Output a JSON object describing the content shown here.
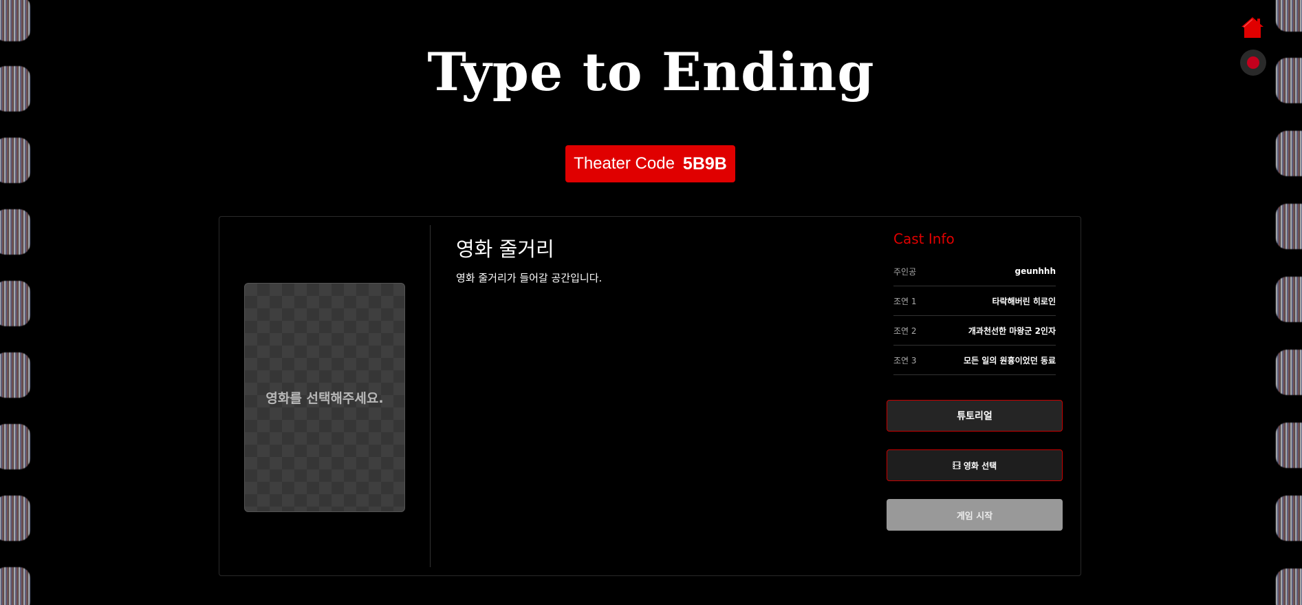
{
  "app": {
    "title": "Type to Ending"
  },
  "theater": {
    "label": "Theater Code",
    "code": "5B9B"
  },
  "poster": {
    "placeholder": "영화를 선택해주세요."
  },
  "synopsis": {
    "title": "영화 줄거리",
    "body": "영화 줄거리가 들어갈 공간입니다."
  },
  "cast": {
    "title": "Cast Info",
    "rows": [
      {
        "role": "주인공",
        "name": "geunhhh"
      },
      {
        "role": "조연 1",
        "name": "타락해버린 히로인"
      },
      {
        "role": "조연 2",
        "name": "개과천선한 마왕군 2인자"
      },
      {
        "role": "조연 3",
        "name": "모든 일의 원흉이었던 동료"
      }
    ]
  },
  "buttons": {
    "tutorial": "튜토리얼",
    "select_movie": "영화 선택",
    "start_game": "게임 시작"
  },
  "icons": {
    "home": "home-icon",
    "record": "record-icon",
    "film": "film-icon"
  },
  "colors": {
    "accent": "#e00000",
    "background": "#000000",
    "disabled": "#999999"
  }
}
